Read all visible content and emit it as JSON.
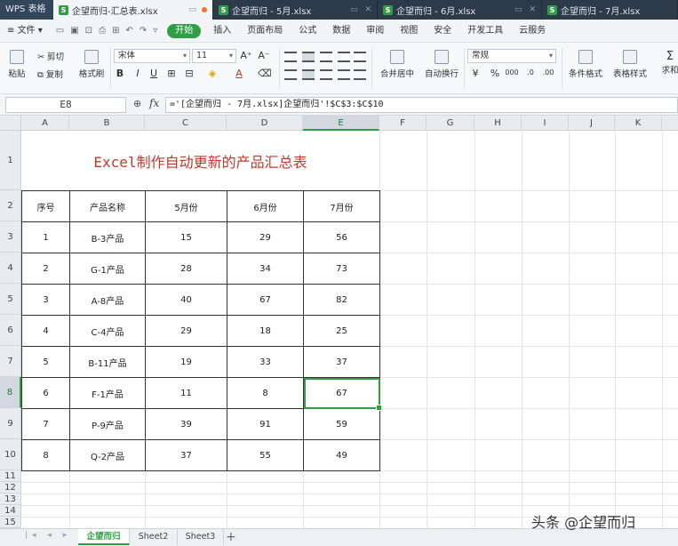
{
  "tabs": {
    "app": "WPS 表格",
    "docs": [
      {
        "label": "企望而归-汇总表.xlsx",
        "active": true
      },
      {
        "label": "企望而归 - 5月.xlsx",
        "active": false
      },
      {
        "label": "企望而归 - 6月.xlsx",
        "active": false
      },
      {
        "label": "企望而归 - 7月.xlsx",
        "active": false
      }
    ]
  },
  "menu": {
    "file": "文件",
    "items": [
      "开始",
      "插入",
      "页面布局",
      "公式",
      "数据",
      "审阅",
      "视图",
      "安全",
      "开发工具",
      "云服务"
    ]
  },
  "ribbon": {
    "paste": "粘贴",
    "cut": "剪切",
    "copy": "复制",
    "format_painter": "格式刷",
    "font_name": "宋体",
    "font_size": "11",
    "merge_center": "合并居中",
    "wrap_text": "自动换行",
    "number_format": "常规",
    "conditional_format": "条件格式",
    "table_style": "表格样式",
    "sum": "求和",
    "bold": "B",
    "italic": "I",
    "underline": "U",
    "percent": "%",
    "thousands": "000"
  },
  "formula_bar": {
    "name_box": "E8",
    "fx": "fx",
    "formula": "='[企望而归 - 7月.xlsx]企望而归'!$C$3:$C$10"
  },
  "grid": {
    "columns": [
      "A",
      "B",
      "C",
      "D",
      "E",
      "F",
      "G",
      "H",
      "I",
      "J",
      "K"
    ],
    "rows": [
      "1",
      "2",
      "3",
      "4",
      "5",
      "6",
      "7",
      "8",
      "9",
      "10",
      "11",
      "12",
      "13",
      "14",
      "15"
    ],
    "selected_cell": "E8",
    "title": "Excel制作自动更新的产品汇总表",
    "headers": [
      "序号",
      "产品名称",
      "5月份",
      "6月份",
      "7月份"
    ],
    "data": [
      [
        "1",
        "B-3产品",
        "15",
        "29",
        "56"
      ],
      [
        "2",
        "G-1产品",
        "28",
        "34",
        "73"
      ],
      [
        "3",
        "A-8产品",
        "40",
        "67",
        "82"
      ],
      [
        "4",
        "C-4产品",
        "29",
        "18",
        "25"
      ],
      [
        "5",
        "B-11产品",
        "19",
        "33",
        "37"
      ],
      [
        "6",
        "F-1产品",
        "11",
        "8",
        "67"
      ],
      [
        "7",
        "P-9产品",
        "39",
        "91",
        "59"
      ],
      [
        "8",
        "Q-2产品",
        "37",
        "55",
        "49"
      ]
    ]
  },
  "sheets": [
    "企望而归",
    "Sheet2",
    "Sheet3"
  ],
  "watermark": "头条 @企望而归",
  "accent_color": "#2f9e44"
}
